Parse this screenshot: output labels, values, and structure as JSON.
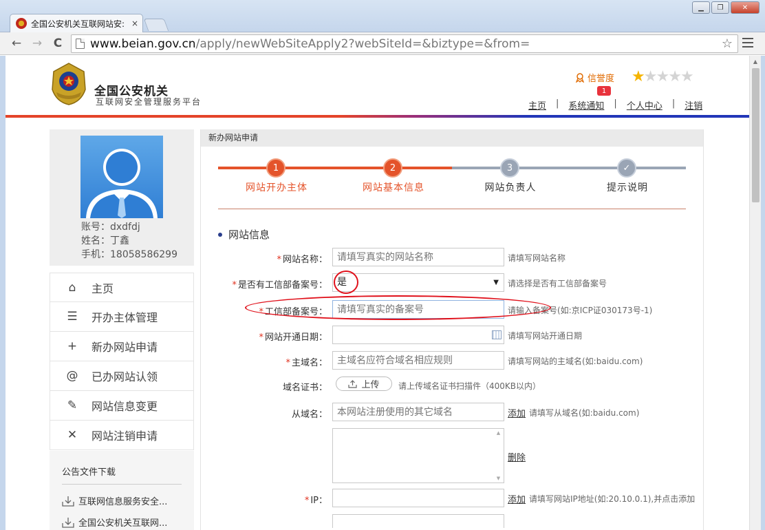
{
  "browser": {
    "tab_title": "全国公安机关互联网站安:",
    "tab_close": "×",
    "url_host": "www.beian.gov.cn",
    "url_rest": "/apply/newWebSiteApply2?webSiteId=&biztype=&from=",
    "back": "←",
    "forward": "→",
    "reload": "C",
    "bookmark_star": "☆",
    "window_buttons": [
      "▁",
      "❐",
      "✕"
    ]
  },
  "header": {
    "site_name": "全国公安机关",
    "site_sub": "互联网安全管理服务平台",
    "credit_label": "信誉度",
    "credit_badge": "1",
    "rating": 1,
    "links": [
      "主页",
      "系统通知",
      "个人中心",
      "注销"
    ]
  },
  "profile": {
    "account": "账号：dxdfdj",
    "name": "姓名：丁鑫",
    "phone": "手机：18058586299"
  },
  "sidebar": {
    "items": [
      {
        "label": "主页",
        "icon": "⌂"
      },
      {
        "label": "开办主体管理",
        "icon": "☰"
      },
      {
        "label": "新办网站申请",
        "icon": "+"
      },
      {
        "label": "已办网站认领",
        "icon": "@"
      },
      {
        "label": "网站信息变更",
        "icon": "✎"
      },
      {
        "label": "网站注销申请",
        "icon": "✕"
      }
    ],
    "notice_title": "公告文件下载",
    "notices": [
      "互联网信息服务安全...",
      "全国公安机关互联网..."
    ]
  },
  "panel": {
    "title": "新办网站申请",
    "steps": [
      {
        "num": "1",
        "label": "网站开办主体"
      },
      {
        "num": "2",
        "label": "网站基本信息"
      },
      {
        "num": "3",
        "label": "网站负责人"
      },
      {
        "num": "✓",
        "label": "提示说明"
      }
    ],
    "section_title": "网站信息"
  },
  "form": {
    "site_name_label": "网站名称：",
    "site_name_placeholder": "请填写真实的网站名称",
    "site_name_hint": "请填写网站名称",
    "miit_label": "是否有工信部备案号：",
    "miit_value": "是",
    "miit_hint": "请选择是否有工信部备案号",
    "miit_no_label": "工信部备案号：",
    "miit_no_placeholder": "请填写真实的备案号",
    "miit_no_hint": "请输入备案号(如:京ICP证030173号-1)",
    "open_date_label": "网站开通日期：",
    "open_date_hint": "请填写网站开通日期",
    "domain_label": "主域名：",
    "domain_placeholder": "主域名应符合域名相应规则",
    "domain_hint": "请填写网站的主域名(如:baidu.com)",
    "cert_label": "域名证书：",
    "upload_label": "上传",
    "cert_hint": "请上传域名证书扫描件（400KB以内）",
    "sub_domain_label": "从域名：",
    "sub_domain_placeholder": "本网站注册使用的其它域名",
    "add_label": "添加",
    "sub_domain_hint": "请填写从域名(如:baidu.com)",
    "delete_label": "删除",
    "ip_label": "IP：",
    "ip_add_label": "添加",
    "ip_hint": "请填写网站IP地址(如:20.10.0.1),并点击添加"
  },
  "colors": {
    "accent_orange": "#e4532a",
    "inactive_gray": "#9aa5b5",
    "required_red": "#e0301e",
    "annotation_red": "#e0101a"
  }
}
